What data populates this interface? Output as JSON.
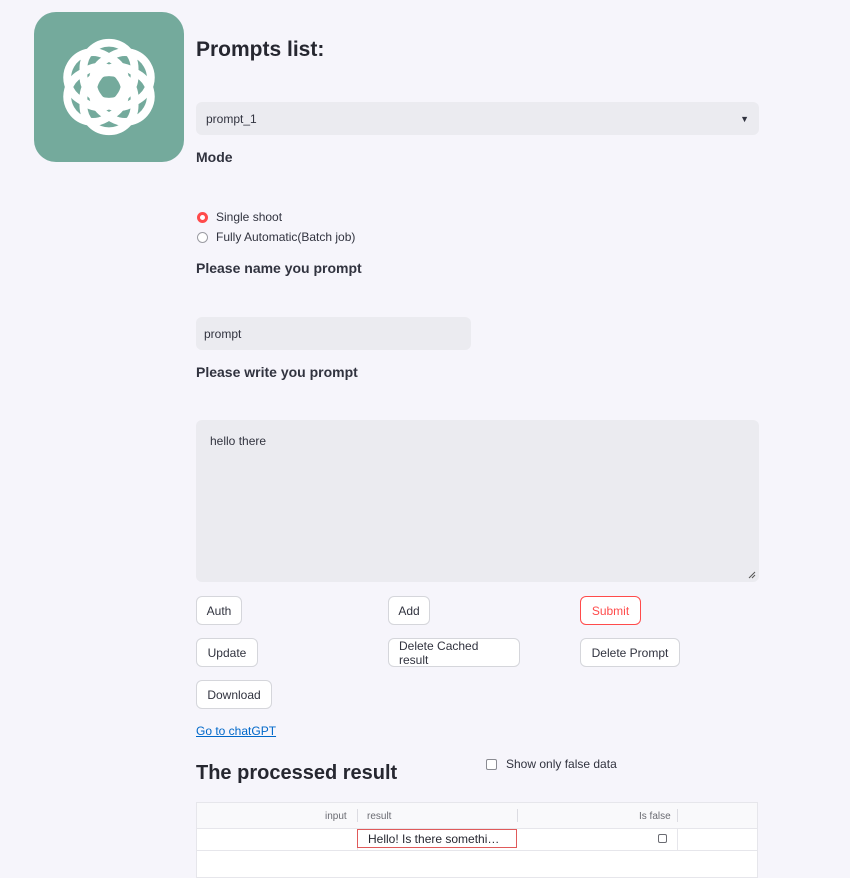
{
  "header": {
    "title": "Prompts list:"
  },
  "prompt_select": {
    "selected": "prompt_1"
  },
  "mode": {
    "label": "Mode",
    "options": [
      "Single shoot",
      "Fully Automatic(Batch job)"
    ],
    "selected_index": 0
  },
  "name_field": {
    "label": "Please name you prompt",
    "value": "prompt"
  },
  "prompt_field": {
    "label": "Please write you prompt",
    "value": "hello there"
  },
  "buttons": {
    "auth": "Auth",
    "add": "Add",
    "submit": "Submit",
    "update": "Update",
    "delete_cached": "Delete Cached result",
    "delete_prompt": "Delete Prompt",
    "download": "Download"
  },
  "link": {
    "label": "Go to chatGPT"
  },
  "results": {
    "title": "The processed result",
    "filter_label": "Show only false data",
    "columns": [
      "input",
      "result",
      "Is false"
    ],
    "rows": [
      {
        "input": "",
        "result": "Hello! Is there something I can help you with?",
        "is_false": false
      }
    ]
  },
  "colors": {
    "accent": "#ff4b4b",
    "logo_bg": "#74aa9c",
    "link": "#0068c9"
  },
  "icons": {
    "logo": "openai-logo-icon",
    "dropdown": "chevron-down-icon"
  }
}
